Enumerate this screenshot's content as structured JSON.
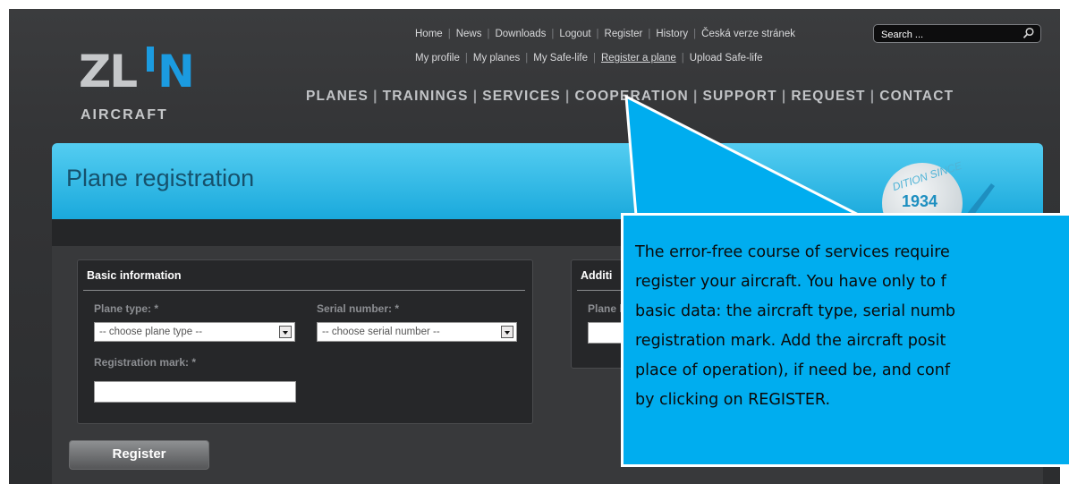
{
  "logo": {
    "zl": "ZL",
    "n": "N",
    "sub": "AIRCRAFT"
  },
  "top_links": [
    "Home",
    "News",
    "Downloads",
    "Logout",
    "Register",
    "History",
    "Česká verze stránek"
  ],
  "sub_links": [
    "My profile",
    "My planes",
    "My Safe-life",
    "Register a plane",
    "Upload Safe-life"
  ],
  "search": {
    "placeholder": "Search ..."
  },
  "main_nav": [
    "PLANES",
    "TRAININGS",
    "SERVICES",
    "COOPERATION",
    "SUPPORT",
    "REQUEST",
    "CONTACT"
  ],
  "page_title": "Plane registration",
  "badge": {
    "since": "DITION SINCE",
    "year": "1934"
  },
  "basic_info": {
    "title": "Basic information",
    "plane_type_label": "Plane type: *",
    "plane_type_value": "-- choose plane type --",
    "serial_label": "Serial number: *",
    "serial_value": "-- choose serial number --",
    "reg_mark_label": "Registration mark: *",
    "reg_mark_value": ""
  },
  "additional": {
    "title": "Additi",
    "plane_lo_label": "Plane lo"
  },
  "register_button": "Register",
  "callout": {
    "lines": [
      "The error-free course of services require",
      "register your aircraft. You have only to f",
      "basic data: the aircraft type, serial numb",
      "registration mark. Add the aircraft posit",
      "place of operation), if need be, and conf",
      "by clicking on REGISTER."
    ]
  }
}
